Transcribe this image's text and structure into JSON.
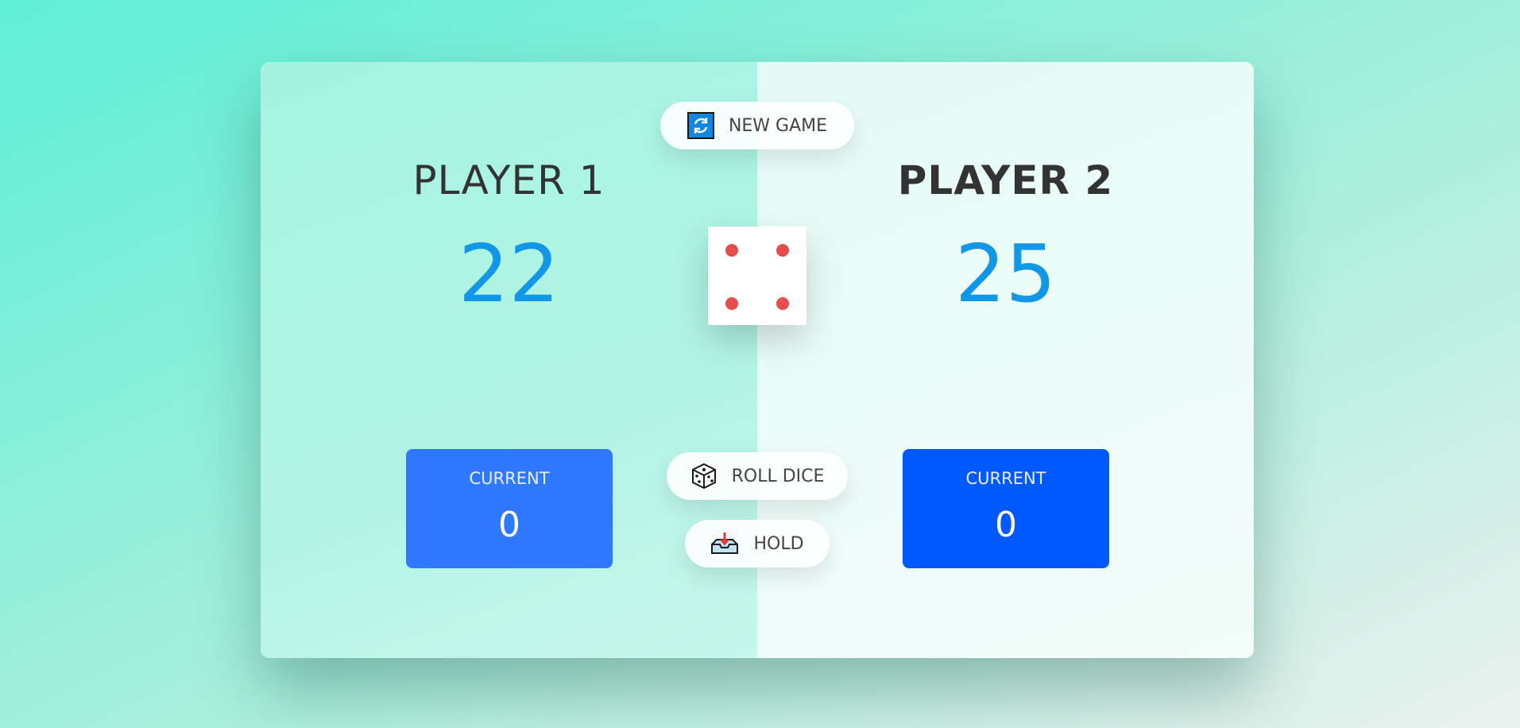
{
  "players": [
    {
      "name": "PLAYER 1",
      "score": "22",
      "current_label": "CURRENT",
      "current_value": "0"
    },
    {
      "name": "PLAYER 2",
      "score": "25",
      "current_label": "CURRENT",
      "current_value": "0"
    }
  ],
  "buttons": {
    "new_game": {
      "label": "NEW GAME",
      "icon": "refresh-icon"
    },
    "roll_dice": {
      "label": "ROLL DICE",
      "icon": "dice-icon"
    },
    "hold": {
      "label": "HOLD",
      "icon": "hold-icon"
    }
  },
  "dice": {
    "value": 4,
    "pip_color": "#e84c4c"
  },
  "colors": {
    "score": "#1296e6",
    "player1_current_bg": "#2e79ff",
    "player2_current_bg": "#0059ff"
  }
}
